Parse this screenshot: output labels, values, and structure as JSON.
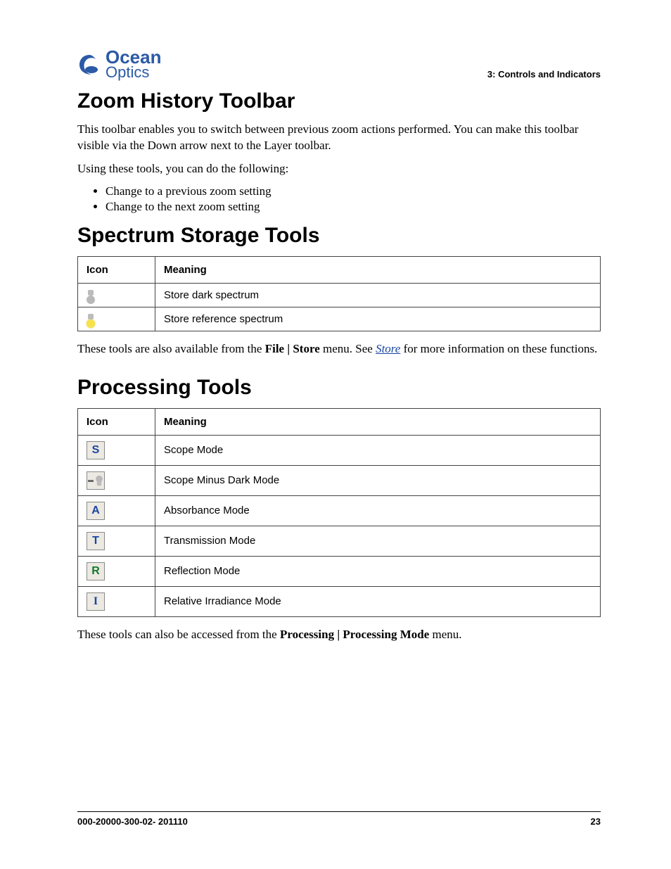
{
  "header": {
    "logo_line1": "Ocean",
    "logo_line2": "Optics",
    "section": "3: Controls and Indicators"
  },
  "zoom": {
    "heading": "Zoom History Toolbar",
    "para1": "This toolbar enables you to switch between previous zoom actions performed. You can make this toolbar visible via the Down arrow next to the Layer toolbar.",
    "para2": "Using these tools, you can do the following:",
    "bullets": {
      "0": "Change to a previous zoom setting",
      "1": "Change to the next zoom setting"
    }
  },
  "storage": {
    "heading": "Spectrum Storage Tools",
    "col_icon": "Icon",
    "col_meaning": "Meaning",
    "rows": {
      "0": {
        "meaning": "Store dark spectrum"
      },
      "1": {
        "meaning": "Store reference spectrum"
      }
    },
    "note_before": "These tools are also available from the ",
    "note_bold": "File | Store",
    "note_mid": " menu. See ",
    "note_link": "Store",
    "note_after": " for more information on these functions."
  },
  "processing": {
    "heading": "Processing Tools",
    "col_icon": "Icon",
    "col_meaning": "Meaning",
    "rows": {
      "0": {
        "glyph": "S",
        "meaning": "Scope Mode"
      },
      "1": {
        "meaning": "Scope Minus Dark Mode"
      },
      "2": {
        "glyph": "A",
        "meaning": "Absorbance Mode"
      },
      "3": {
        "glyph": "T",
        "meaning": "Transmission Mode"
      },
      "4": {
        "glyph": "R",
        "meaning": "Reflection Mode"
      },
      "5": {
        "glyph": "I",
        "meaning": "Relative Irradiance Mode"
      }
    },
    "note_before": "These tools can also be accessed from the ",
    "note_bold": "Processing | Processing Mode",
    "note_after": " menu."
  },
  "footer": {
    "docnum": "000-20000-300-02- 201110",
    "page": "23"
  }
}
